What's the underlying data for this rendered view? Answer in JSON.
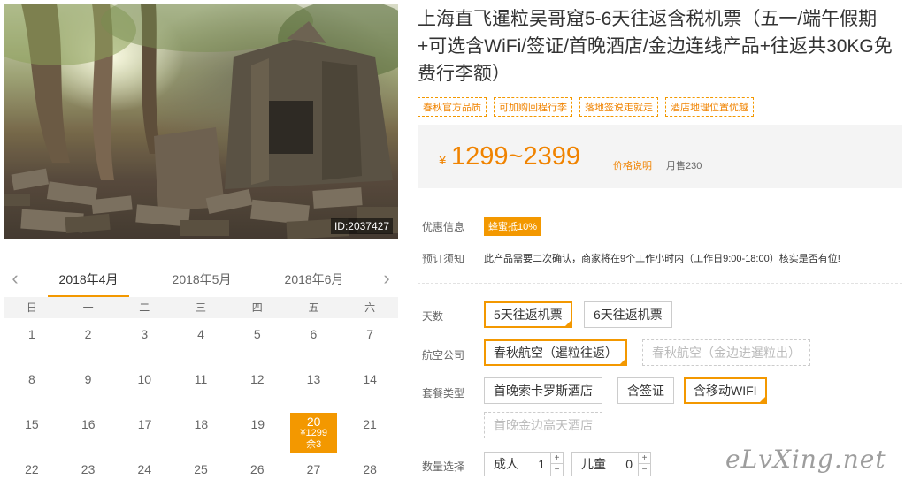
{
  "hero": {
    "image_id": "ID:2037427"
  },
  "calendar": {
    "months": [
      "2018年4月",
      "2018年5月",
      "2018年6月"
    ],
    "active_month_index": 0,
    "weekdays": [
      "日",
      "一",
      "二",
      "三",
      "四",
      "五",
      "六"
    ],
    "weeks": [
      [
        "1",
        "2",
        "3",
        "4",
        "5",
        "6",
        "7"
      ],
      [
        "8",
        "9",
        "10",
        "11",
        "12",
        "13",
        "14"
      ],
      [
        "15",
        "16",
        "17",
        "18",
        "19",
        "20",
        "21"
      ],
      [
        "22",
        "23",
        "24",
        "25",
        "26",
        "27",
        "28"
      ]
    ],
    "available_day": {
      "day": "20",
      "price": "¥1299",
      "remaining": "余3"
    }
  },
  "product": {
    "title": "上海直飞暹粒吴哥窟5-6天往返含税机票（五一/端午假期+可选含WiFi/签证/首晚酒店/金边连线产品+往返共30KG免费行李额）",
    "tags": [
      "春秋官方品质",
      "可加购回程行李",
      "落地签说走就走",
      "酒店地理位置优越"
    ],
    "price": {
      "currency": "¥",
      "range": "1299~2399",
      "explain_label": "价格说明",
      "sold_label": "月售230"
    },
    "promo": {
      "label": "优惠信息",
      "badge": "蜂蜜抵10%"
    },
    "notice": {
      "label": "预订须知",
      "text": "此产品需要二次确认，商家将在9个工作小时内（工作日9:00-18:00）核实是否有位!"
    },
    "days": {
      "label": "天数",
      "options": [
        "5天往返机票",
        "6天往返机票"
      ],
      "selected": 0
    },
    "airline": {
      "label": "航空公司",
      "options": [
        "春秋航空（暹粒往返）",
        "春秋航空（金边进暹粒出）"
      ],
      "selected": 0
    },
    "package": {
      "label": "套餐类型",
      "options": [
        "首晚索卡罗斯酒店",
        "含签证",
        "含移动WIFI",
        "首晚金边高天酒店"
      ],
      "selected": 2
    },
    "quantity": {
      "label": "数量选择",
      "adult_label": "成人",
      "adult_value": "1",
      "child_label": "儿童",
      "child_value": "0",
      "plus": "+",
      "minus": "−"
    }
  },
  "watermark": "eLvXing.net",
  "colors": {
    "accent": "#f39800",
    "price": "#f08300"
  }
}
